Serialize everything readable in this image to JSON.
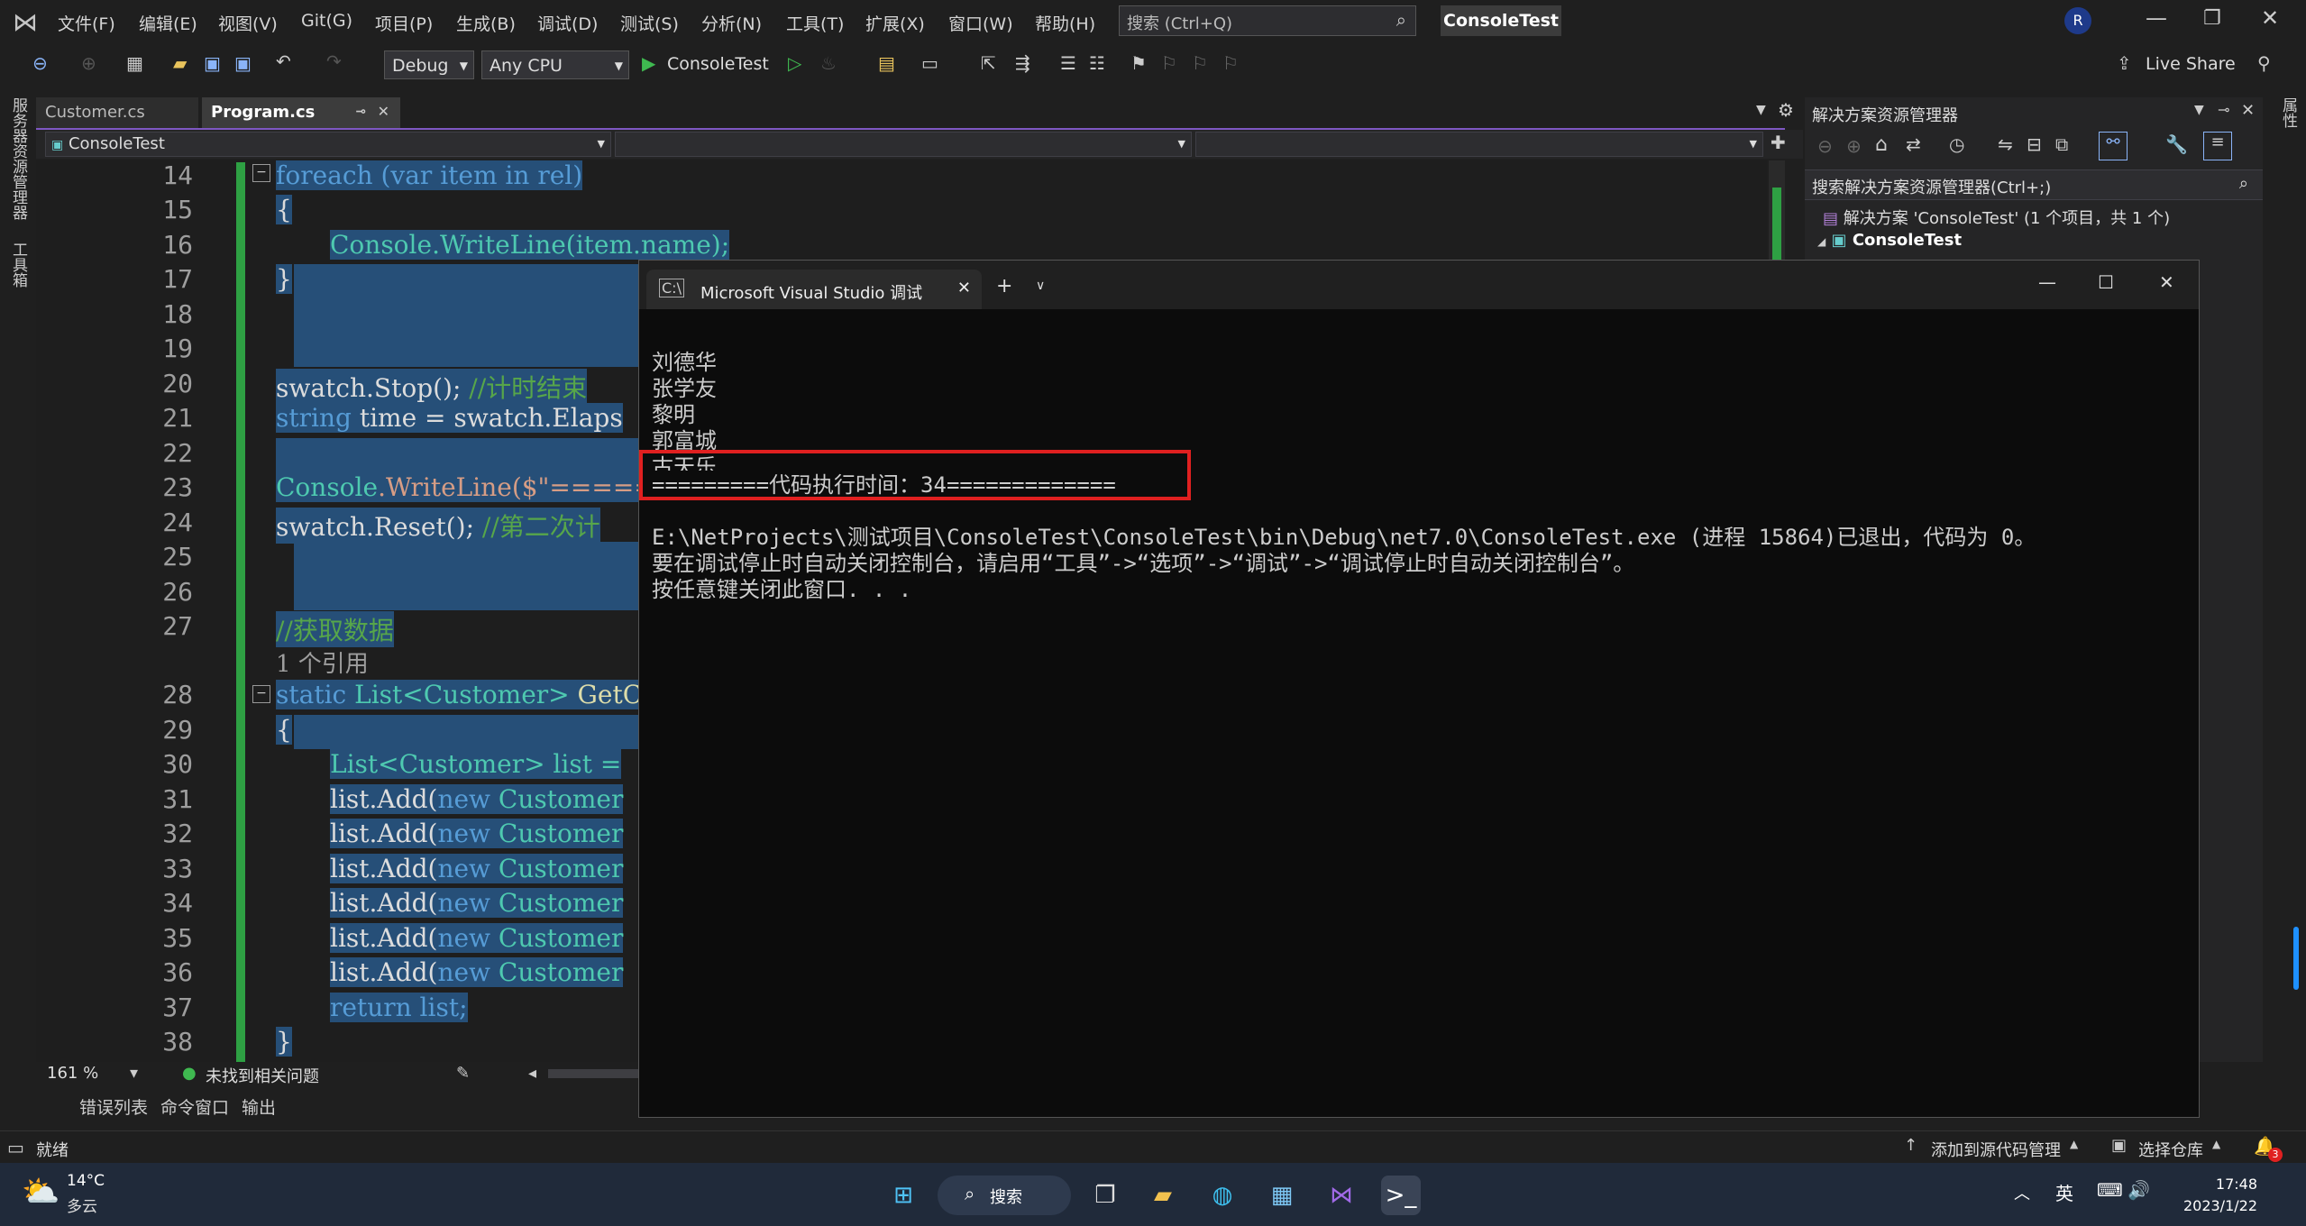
{
  "menubar": {
    "items": [
      "文件(F)",
      "编辑(E)",
      "视图(V)",
      "Git(G)",
      "项目(P)",
      "生成(B)",
      "调试(D)",
      "测试(S)",
      "分析(N)",
      "工具(T)",
      "扩展(X)",
      "窗口(W)",
      "帮助(H)"
    ],
    "search_placeholder": "搜索 (Ctrl+Q)",
    "project_title": "ConsoleTest",
    "user_initial": "R"
  },
  "toolbar": {
    "config": "Debug",
    "platform": "Any CPU",
    "run_target": "ConsoleTest",
    "live_share": "Live Share"
  },
  "left_strip": [
    "服务器资源管理器",
    "工具箱"
  ],
  "right_strip": [
    "属性"
  ],
  "tabs": [
    {
      "label": "Customer.cs"
    },
    {
      "label": "Program.cs"
    }
  ],
  "navbar": {
    "project": "ConsoleTest"
  },
  "editor": {
    "line_numbers": [
      "14",
      "15",
      "16",
      "17",
      "18",
      "19",
      "20",
      "21",
      "22",
      "23",
      "24",
      "25",
      "26",
      "27",
      "28",
      "29",
      "30",
      "31",
      "32",
      "33",
      "34",
      "35",
      "36",
      "37",
      "38"
    ],
    "refs_hint": "1 个引用",
    "lines": {
      "l14": "foreach (var item in rel)",
      "l15": "{",
      "l16": "Console.WriteLine(item.name);",
      "l17": "}",
      "l20a": "swatch.Stop(); ",
      "l20b": "//计时结束",
      "l21a": "string",
      "l21b": " time = swatch.Elaps",
      "l23a": "Console",
      "l23b": ".WriteLine($\"=====",
      "l24a": "swatch.Reset(); ",
      "l24b": "//第二次计",
      "l27": "//获取数据",
      "l28a": "static ",
      "l28b": "List",
      "l28c": "<Customer>",
      "l28d": " GetC",
      "l29": "{",
      "l30": "List<Customer> list =",
      "list_add": "list.Add(",
      "new_kw": "new",
      "customer": " Customer",
      "l37": "return list;",
      "l38": "}"
    }
  },
  "status_row": {
    "zoom": "161 %",
    "issues": "未找到相关问题"
  },
  "bottom_tabs": [
    "错误列表",
    "命令窗口",
    "输出"
  ],
  "solution_explorer": {
    "title": "解决方案资源管理器",
    "search": "搜索解决方案资源管理器(Ctrl+;)",
    "solution": "解决方案 'ConsoleTest' (1 个项目，共 1 个)",
    "project": "ConsoleTest"
  },
  "console": {
    "tab_title": "Microsoft Visual Studio 调试",
    "output_lines": [
      "刘德华",
      "张学友",
      "黎明",
      "郭富城",
      "古天乐"
    ],
    "timing_line": "=========代码执行时间：34=============",
    "exit_line1": "E:\\NetProjects\\测试项目\\ConsoleTest\\ConsoleTest\\bin\\Debug\\net7.0\\ConsoleTest.exe (进程 15864)已退出，代码为 0。",
    "exit_line2": "要在调试停止时自动关闭控制台，请启用“工具”->“选项”->“调试”->“调试停止时自动关闭控制台”。",
    "exit_line3": "按任意键关闭此窗口. . ."
  },
  "statusbar": {
    "ready": "就绪",
    "source_control": "添加到源代码管理",
    "repo": "选择仓库",
    "notif_count": "3"
  },
  "taskbar": {
    "weather_temp": "14°C",
    "weather_desc": "多云",
    "search_label": "搜索",
    "ime": "英",
    "time": "17:48",
    "date": "2023/1/22"
  },
  "colors": {
    "accent": "#7e57c2",
    "selection": "#264f78",
    "keyword": "#569cd6",
    "type": "#4ec9b0",
    "comment": "#57a64a",
    "highlight_box": "#e02020"
  }
}
